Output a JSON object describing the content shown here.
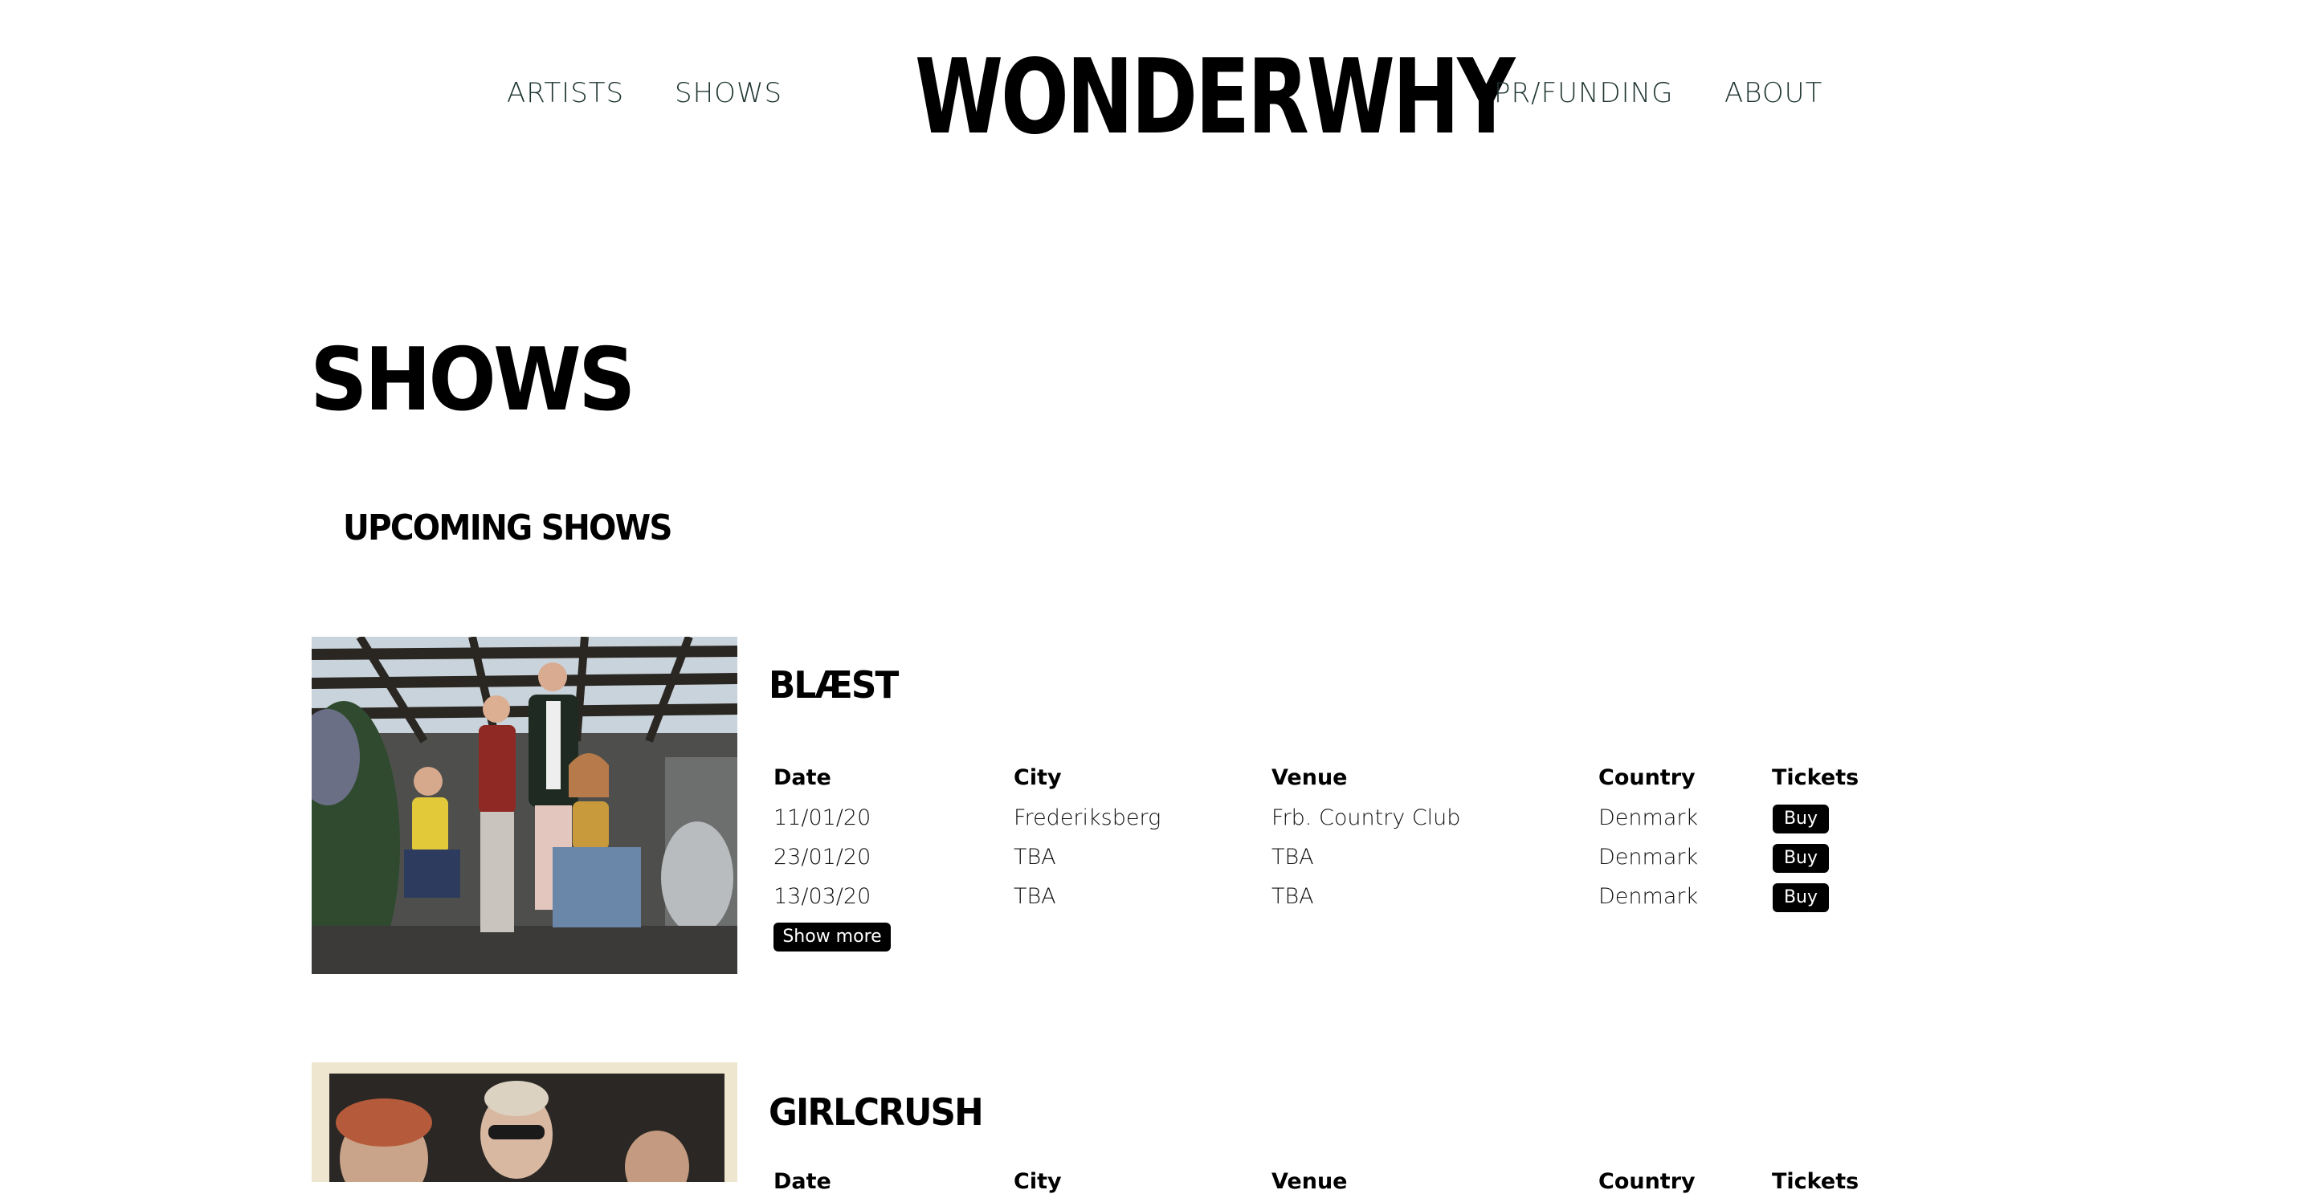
{
  "nav": {
    "left": [
      "ARTISTS",
      "SHOWS"
    ],
    "logo": "WONDERWHY",
    "right": [
      "PR/FUNDING",
      "ABOUT"
    ]
  },
  "page_title": "SHOWS",
  "section_title": "UPCOMING SHOWS",
  "table_headers": [
    "Date",
    "City",
    "Venue",
    "Country",
    "Tickets"
  ],
  "artists": [
    {
      "name": "BLÆST",
      "shows": [
        {
          "date": "11/01/20",
          "city": "Frederiksberg",
          "venue": "Frb. Country Club",
          "country": "Denmark",
          "ticket": "Buy"
        },
        {
          "date": "23/01/20",
          "city": "TBA",
          "venue": "TBA",
          "country": "Denmark",
          "ticket": "Buy"
        },
        {
          "date": "13/03/20",
          "city": "TBA",
          "venue": "TBA",
          "country": "Denmark",
          "ticket": "Buy"
        }
      ],
      "show_more": "Show more"
    },
    {
      "name": "GIRLCRUSH",
      "shows": []
    }
  ]
}
